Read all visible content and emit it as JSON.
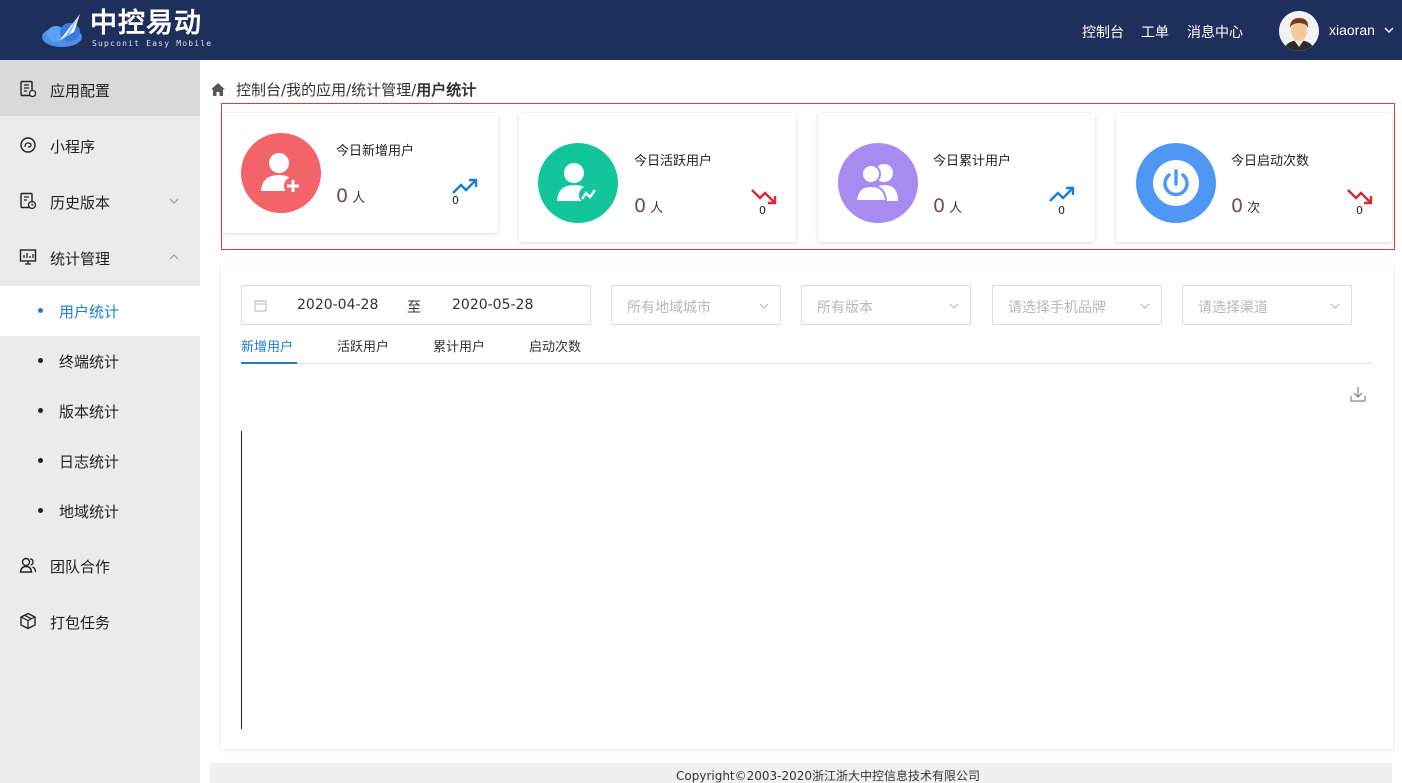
{
  "header": {
    "logo_title": "中控易动",
    "logo_subtitle": "Supconit Easy Mobile",
    "nav": [
      "控制台",
      "工单",
      "消息中心"
    ],
    "username": "xiaoran",
    "bg_color": "#1f2f5b"
  },
  "sidebar": {
    "items": [
      {
        "label": "应用配置",
        "icon": "app-config-icon",
        "active": true
      },
      {
        "label": "小程序",
        "icon": "mini-program-icon"
      },
      {
        "label": "历史版本",
        "icon": "history-icon",
        "chevron": "down"
      },
      {
        "label": "统计管理",
        "icon": "chart-icon",
        "chevron": "up"
      }
    ],
    "sub_items": [
      {
        "label": "用户统计",
        "active": true
      },
      {
        "label": "终端统计"
      },
      {
        "label": "版本统计"
      },
      {
        "label": "日志统计"
      },
      {
        "label": "地域统计"
      }
    ],
    "bottom_items": [
      {
        "label": "团队合作",
        "icon": "team-icon"
      },
      {
        "label": "打包任务",
        "icon": "package-icon"
      }
    ]
  },
  "breadcrumb": {
    "parts": [
      "控制台",
      "我的应用",
      "统计管理"
    ],
    "current": "用户统计",
    "sep": "/"
  },
  "stats": [
    {
      "title": "今日新增用户",
      "value": "0",
      "unit": "人",
      "trend": "up",
      "trend_value": "0",
      "color": "#f2636a",
      "icon": "add-user-icon"
    },
    {
      "title": "今日活跃用户",
      "value": "0",
      "unit": "人",
      "trend": "down",
      "trend_value": "0",
      "color": "#12c59a",
      "icon": "active-user-icon"
    },
    {
      "title": "今日累计用户",
      "value": "0",
      "unit": "人",
      "trend": "up",
      "trend_value": "0",
      "color": "#a78bf0",
      "icon": "users-group-icon"
    },
    {
      "title": "今日启动次数",
      "value": "0",
      "unit": "次",
      "trend": "down",
      "trend_value": "0",
      "color": "#4f97f5",
      "icon": "power-icon"
    }
  ],
  "filters": {
    "date_start": "2020-04-28",
    "date_sep": "至",
    "date_end": "2020-05-28",
    "selects": [
      "所有地域城市",
      "所有版本",
      "请选择手机品牌",
      "请选择渠道"
    ]
  },
  "tabs": [
    {
      "label": "新增用户",
      "active": true
    },
    {
      "label": "活跃用户"
    },
    {
      "label": "累计用户"
    },
    {
      "label": "启动次数"
    }
  ],
  "footer": {
    "text": "Copyright©2003-2020浙江浙大中控信息技术有限公司"
  },
  "colors": {
    "accent": "#1a7fd4",
    "trend_up": "#1a7fd4",
    "trend_down": "#d8283a",
    "highlight_border": "#e03b3b"
  }
}
